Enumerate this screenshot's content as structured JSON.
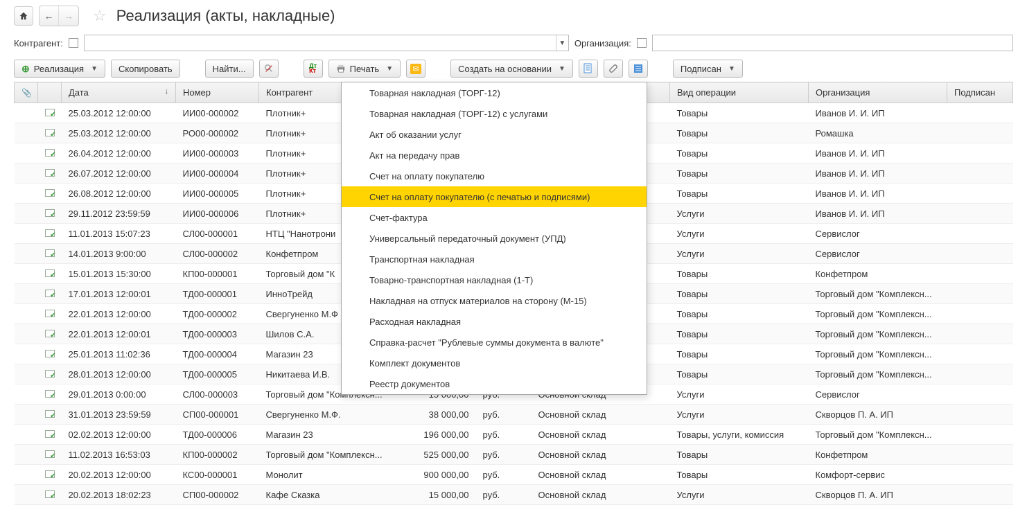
{
  "header": {
    "title": "Реализация (акты, накладные)"
  },
  "filters": {
    "counterparty_label": "Контрагент:",
    "organization_label": "Организация:"
  },
  "toolbar": {
    "create_label": "Реализация",
    "copy_label": "Скопировать",
    "find_label": "Найти...",
    "print_label": "Печать",
    "create_basis_label": "Создать на основании",
    "signed_label": "Подписан"
  },
  "print_menu": {
    "items": [
      "Товарная накладная (ТОРГ-12)",
      "Товарная накладная (ТОРГ-12) с услугами",
      "Акт об оказании услуг",
      "Акт на передачу прав",
      "Счет на оплату покупателю",
      "Счет на оплату покупателю (с печатью и подписями)",
      "Счет-фактура",
      "Универсальный передаточный документ (УПД)",
      "Транспортная накладная",
      "Товарно-транспортная накладная (1-Т)",
      "Накладная на отпуск материалов на сторону (М-15)",
      "Расходная накладная",
      "Справка-расчет \"Рублевые суммы документа в валюте\"",
      "Комплект документов",
      "Реестр документов"
    ],
    "highlight_index": 5
  },
  "columns": {
    "date": "Дата",
    "number": "Номер",
    "counterparty": "Контрагент",
    "operation": "Вид операции",
    "organization": "Организация",
    "signed": "Подписан"
  },
  "rows": [
    {
      "date": "25.03.2012 12:00:00",
      "number": "ИИ00-000002",
      "cagent": "Плотник+",
      "sum": "",
      "cur": "",
      "whs": "",
      "op": "Товары",
      "org": "Иванов И. И. ИП"
    },
    {
      "date": "25.03.2012 12:00:00",
      "number": "РО00-000002",
      "cagent": "Плотник+",
      "sum": "",
      "cur": "",
      "whs": "",
      "op": "Товары",
      "org": "Ромашка"
    },
    {
      "date": "26.04.2012 12:00:00",
      "number": "ИИ00-000003",
      "cagent": "Плотник+",
      "sum": "",
      "cur": "",
      "whs": "",
      "op": "Товары",
      "org": "Иванов И. И. ИП"
    },
    {
      "date": "26.07.2012 12:00:00",
      "number": "ИИ00-000004",
      "cagent": "Плотник+",
      "sum": "",
      "cur": "",
      "whs": "",
      "op": "Товары",
      "org": "Иванов И. И. ИП"
    },
    {
      "date": "26.08.2012 12:00:00",
      "number": "ИИ00-000005",
      "cagent": "Плотник+",
      "sum": "",
      "cur": "",
      "whs": "",
      "op": "Товары",
      "org": "Иванов И. И. ИП"
    },
    {
      "date": "29.11.2012 23:59:59",
      "number": "ИИ00-000006",
      "cagent": "Плотник+",
      "sum": "",
      "cur": "",
      "whs": "",
      "op": "Услуги",
      "org": "Иванов И. И. ИП"
    },
    {
      "date": "11.01.2013 15:07:23",
      "number": "СЛ00-000001",
      "cagent": "НТЦ \"Нанотрони",
      "sum": "",
      "cur": "",
      "whs": "",
      "op": "Услуги",
      "org": "Сервислог"
    },
    {
      "date": "14.01.2013 9:00:00",
      "number": "СЛ00-000002",
      "cagent": "Конфетпром",
      "sum": "",
      "cur": "",
      "whs": "",
      "op": "Услуги",
      "org": "Сервислог"
    },
    {
      "date": "15.01.2013 15:30:00",
      "number": "КП00-000001",
      "cagent": "Торговый дом \"К",
      "sum": "",
      "cur": "",
      "whs": "",
      "op": "Товары",
      "org": "Конфетпром"
    },
    {
      "date": "17.01.2013 12:00:01",
      "number": "ТД00-000001",
      "cagent": "ИнноТрейд",
      "sum": "",
      "cur": "",
      "whs": "",
      "op": "Товары",
      "org": "Торговый дом \"Комплексн..."
    },
    {
      "date": "22.01.2013 12:00:00",
      "number": "ТД00-000002",
      "cagent": "Свергуненко М.Ф",
      "sum": "",
      "cur": "",
      "whs": "",
      "op": "Товары",
      "org": "Торговый дом \"Комплексн..."
    },
    {
      "date": "22.01.2013 12:00:01",
      "number": "ТД00-000003",
      "cagent": "Шилов С.А.",
      "sum": "",
      "cur": "",
      "whs": "",
      "op": "Товары",
      "org": "Торговый дом \"Комплексн..."
    },
    {
      "date": "25.01.2013 11:02:36",
      "number": "ТД00-000004",
      "cagent": "Магазин 23",
      "sum": "",
      "cur": "",
      "whs": "",
      "op": "Товары",
      "org": "Торговый дом \"Комплексн..."
    },
    {
      "date": "28.01.2013 12:00:00",
      "number": "ТД00-000005",
      "cagent": "Никитаева И.В.",
      "sum": "",
      "cur": "",
      "whs": "",
      "op": "Товары",
      "org": "Торговый дом \"Комплексн..."
    },
    {
      "date": "29.01.2013 0:00:00",
      "number": "СЛ00-000003",
      "cagent": "Торговый дом \"Комплексн...",
      "sum": "15 000,00",
      "cur": "руб.",
      "whs": "Основной склад",
      "op": "Услуги",
      "org": "Сервислог"
    },
    {
      "date": "31.01.2013 23:59:59",
      "number": "СП00-000001",
      "cagent": "Свергуненко М.Ф.",
      "sum": "38 000,00",
      "cur": "руб.",
      "whs": "Основной склад",
      "op": "Услуги",
      "org": "Скворцов П. А. ИП"
    },
    {
      "date": "02.02.2013 12:00:00",
      "number": "ТД00-000006",
      "cagent": "Магазин 23",
      "sum": "196 000,00",
      "cur": "руб.",
      "whs": "Основной склад",
      "op": "Товары, услуги, комиссия",
      "org": "Торговый дом \"Комплексн..."
    },
    {
      "date": "11.02.2013 16:53:03",
      "number": "КП00-000002",
      "cagent": "Торговый дом \"Комплексн...",
      "sum": "525 000,00",
      "cur": "руб.",
      "whs": "Основной склад",
      "op": "Товары",
      "org": "Конфетпром"
    },
    {
      "date": "20.02.2013 12:00:00",
      "number": "КС00-000001",
      "cagent": "Монолит",
      "sum": "900 000,00",
      "cur": "руб.",
      "whs": "Основной склад",
      "op": "Товары",
      "org": "Комфорт-сервис"
    },
    {
      "date": "20.02.2013 18:02:23",
      "number": "СП00-000002",
      "cagent": "Кафе Сказка",
      "sum": "15 000,00",
      "cur": "руб.",
      "whs": "Основной склад",
      "op": "Услуги",
      "org": "Скворцов П. А. ИП"
    }
  ]
}
